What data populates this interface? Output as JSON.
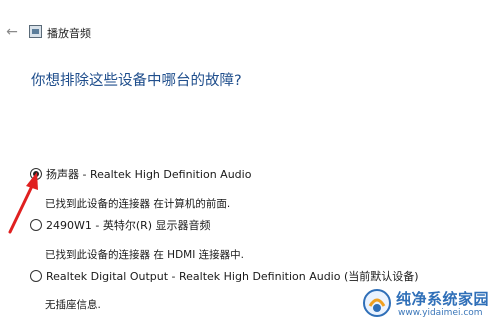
{
  "window": {
    "title": "播放音频",
    "back_icon": "back-arrow-icon",
    "app_icon": "audio-troubleshooter-icon"
  },
  "question": "你想排除这些设备中哪台的故障?",
  "devices": [
    {
      "label": "扬声器 - Realtek High Definition Audio",
      "description": "已找到此设备的连接器 在计算机的前面.",
      "selected": true
    },
    {
      "label": "2490W1 - 英特尔(R) 显示器音频",
      "description": "已找到此设备的连接器 在 HDMI 连接器中.",
      "selected": false
    },
    {
      "label": "Realtek Digital Output - Realtek High Definition Audio (当前默认设备)",
      "description": "无插座信息.",
      "selected": false
    }
  ],
  "watermark": {
    "title": "纯净系统家园",
    "url": "www.yidaimei.com"
  },
  "colors": {
    "question": "#1f4e8c",
    "annotation_arrow": "#e02020",
    "watermark": "#2f6fb8"
  }
}
